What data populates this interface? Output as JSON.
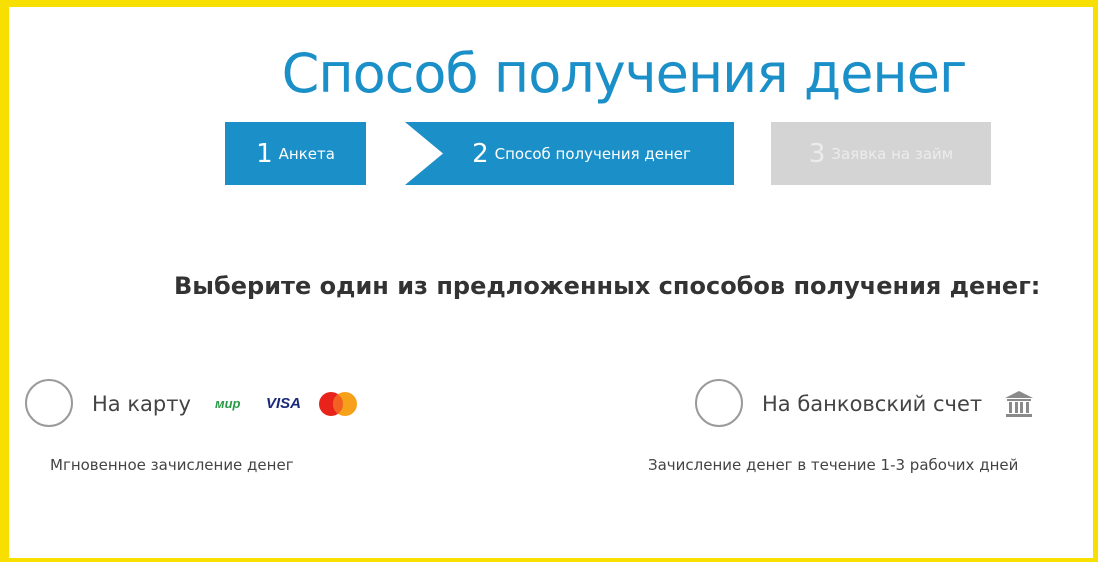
{
  "title": "Способ получения денег",
  "steps": [
    {
      "num": "1",
      "label": "Анкета",
      "state": "done"
    },
    {
      "num": "2",
      "label": "Способ получения денег",
      "state": "active"
    },
    {
      "num": "3",
      "label": "Заявка на займ",
      "state": "inactive"
    }
  ],
  "subtitle": "Выберите один из предложенных способов получения денег:",
  "options": {
    "card": {
      "label": "На карту",
      "brands": {
        "mir": "мир",
        "visa": "VISA"
      },
      "description": "Мгновенное зачисление денег"
    },
    "bank": {
      "label": "На банковский счет",
      "description": "Зачисление денег в течение 1-3 рабочих дней"
    }
  },
  "colors": {
    "accent": "#1a8fc8",
    "frame": "#f7e000",
    "inactive": "#d4d4d4"
  }
}
